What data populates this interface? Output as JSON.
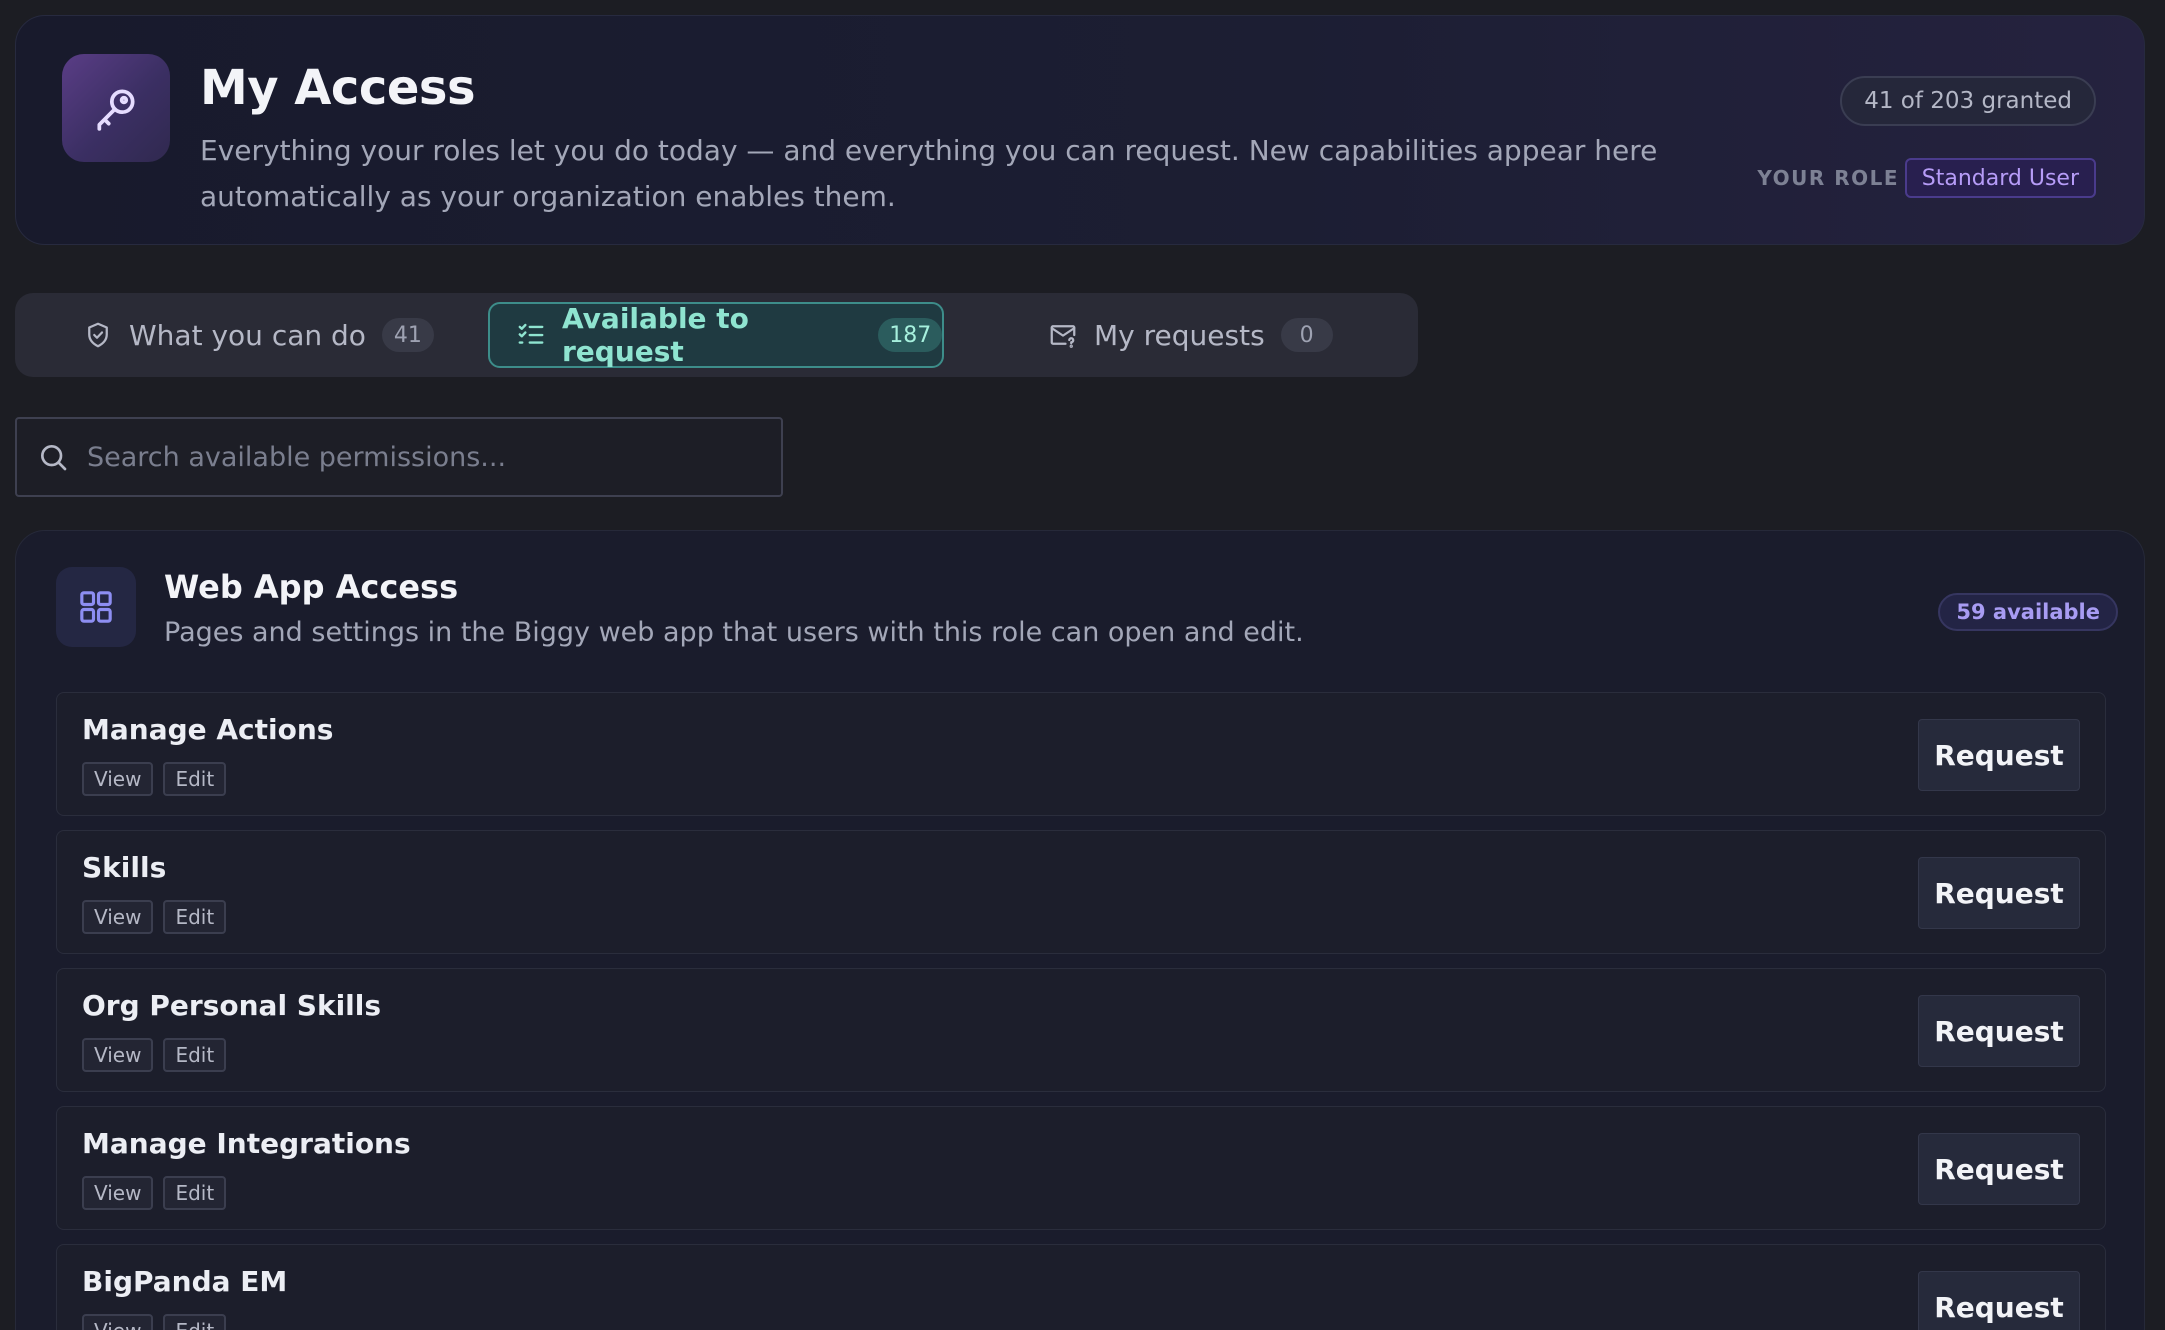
{
  "header": {
    "title": "My Access",
    "subtitle": "Everything your roles let you do today — and everything you can request. New capabilities appear here automatically as your organization enables them.",
    "granted": "41 of 203 granted",
    "role_label": "YOUR ROLE",
    "role": "Standard User",
    "icon": "key-icon"
  },
  "tabs": [
    {
      "label": "What you can do",
      "count": "41",
      "icon": "shield-check-icon"
    },
    {
      "label": "Available to request",
      "count": "187",
      "icon": "checklist-icon",
      "active": true
    },
    {
      "label": "My requests",
      "count": "0",
      "icon": "mail-question-icon"
    }
  ],
  "search": {
    "placeholder": "Search available permissions..."
  },
  "section": {
    "title": "Web App Access",
    "description": "Pages and settings in the Biggy web app that users with this role can open and edit.",
    "available": "59 available",
    "icon": "grid-icon"
  },
  "permissions": [
    {
      "name": "Manage Actions",
      "chips": [
        "View",
        "Edit"
      ],
      "action": "Request"
    },
    {
      "name": "Skills",
      "chips": [
        "View",
        "Edit"
      ],
      "action": "Request"
    },
    {
      "name": "Org Personal Skills",
      "chips": [
        "View",
        "Edit"
      ],
      "action": "Request"
    },
    {
      "name": "Manage Integrations",
      "chips": [
        "View",
        "Edit"
      ],
      "action": "Request"
    },
    {
      "name": "BigPanda EM",
      "chips": [
        "View",
        "Edit"
      ],
      "action": "Request"
    }
  ],
  "colors": {
    "accent_teal": "#8fe4d0",
    "accent_purple": "#b69cf7",
    "background": "#1c1d23"
  }
}
